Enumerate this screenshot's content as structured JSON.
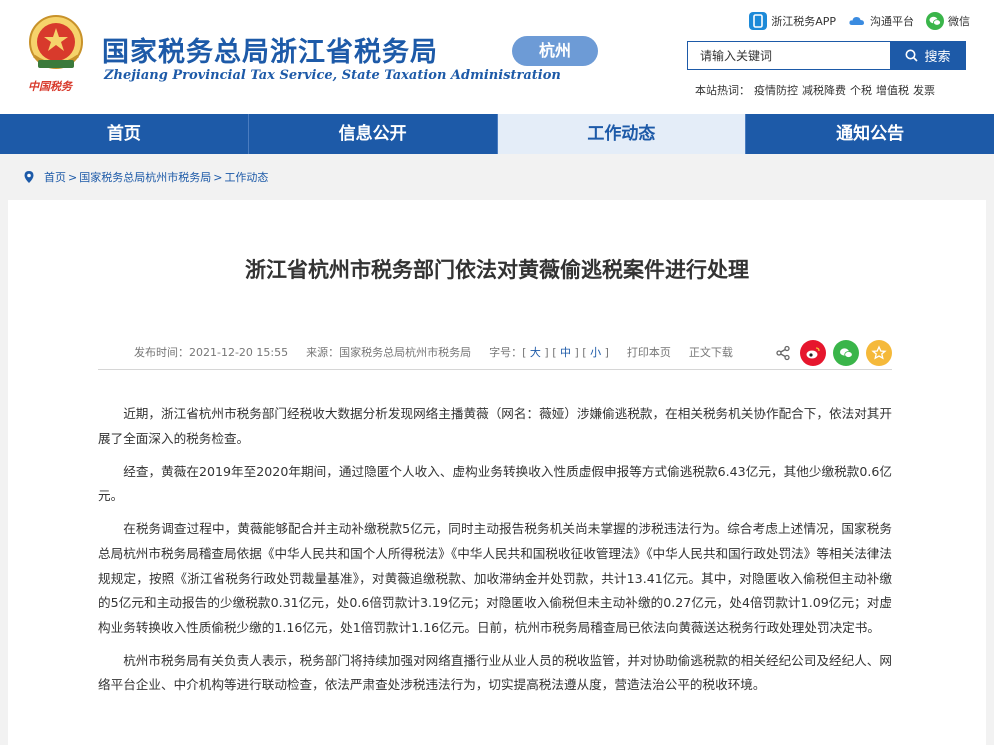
{
  "header": {
    "logo_cn": "国家税务总局浙江省税务局",
    "logo_en": "Zhejiang Provincial Tax Service, State Taxation Administration",
    "emblem_text": "中国税务",
    "city_badge": "杭州",
    "toplinks": [
      {
        "label": "浙江税务APP",
        "icon": "app-icon",
        "color": "#1d8ad8"
      },
      {
        "label": "沟通平台",
        "icon": "cloud-icon",
        "color": "#3a8be0"
      },
      {
        "label": "微信",
        "icon": "wechat-icon",
        "color": "#3ab54a"
      }
    ],
    "search": {
      "placeholder": "请输入关键词",
      "button_label": "搜索"
    },
    "hotwords_label": "本站热词：",
    "hotwords": [
      "疫情防控",
      "减税降费",
      "个税",
      "增值税",
      "发票"
    ]
  },
  "nav": {
    "items": [
      {
        "label": "首页"
      },
      {
        "label": "信息公开"
      },
      {
        "label": "工作动态"
      },
      {
        "label": "通知公告"
      }
    ],
    "active_index": 2
  },
  "breadcrumb": {
    "items": [
      "首页",
      "国家税务总局杭州市税务局",
      "工作动态"
    ],
    "separator": ">"
  },
  "article": {
    "title": "浙江省杭州市税务部门依法对黄薇偷逃税案件进行处理",
    "meta": {
      "publish_time": "发布时间：2021-12-20  15:55",
      "source": "来源：国家税务总局杭州市税务局",
      "font_size_label": "字号：",
      "size_large": "大",
      "size_medium": "中",
      "size_small": "小",
      "print_label": "打印本页",
      "download_label": "正文下载"
    },
    "share_icons": [
      {
        "name": "share-icon",
        "color": "#666666"
      },
      {
        "name": "weibo-icon",
        "color": "#e6162d"
      },
      {
        "name": "wechat-share-icon",
        "color": "#3ab54a"
      },
      {
        "name": "favorite-icon",
        "color": "#f5b93a"
      }
    ],
    "paragraphs": [
      "近期，浙江省杭州市税务部门经税收大数据分析发现网络主播黄薇（网名：薇娅）涉嫌偷逃税款，在相关税务机关协作配合下，依法对其开展了全面深入的税务检查。",
      "经查，黄薇在2019年至2020年期间，通过隐匿个人收入、虚构业务转换收入性质虚假申报等方式偷逃税款6.43亿元，其他少缴税款0.6亿元。",
      "在税务调查过程中，黄薇能够配合并主动补缴税款5亿元，同时主动报告税务机关尚未掌握的涉税违法行为。综合考虑上述情况，国家税务总局杭州市税务局稽查局依据《中华人民共和国个人所得税法》《中华人民共和国税收征收管理法》《中华人民共和国行政处罚法》等相关法律法规规定，按照《浙江省税务行政处罚裁量基准》，对黄薇追缴税款、加收滞纳金并处罚款，共计13.41亿元。其中，对隐匿收入偷税但主动补缴的5亿元和主动报告的少缴税款0.31亿元，处0.6倍罚款计3.19亿元；对隐匿收入偷税但未主动补缴的0.27亿元，处4倍罚款计1.09亿元；对虚构业务转换收入性质偷税少缴的1.16亿元，处1倍罚款计1.16亿元。日前，杭州市税务局稽查局已依法向黄薇送达税务行政处理处罚决定书。",
      "杭州市税务局有关负责人表示，税务部门将持续加强对网络直播行业从业人员的税收监管，并对协助偷逃税款的相关经纪公司及经纪人、网络平台企业、中介机构等进行联动检查，依法严肃查处涉税违法行为，切实提高税法遵从度，营造法治公平的税收环境。"
    ]
  },
  "colors": {
    "brand_blue": "#1d5aa8",
    "nav_active_bg": "#e4edf8",
    "badge_bg": "#6d9bd6",
    "page_bg": "#f2f2f2"
  }
}
